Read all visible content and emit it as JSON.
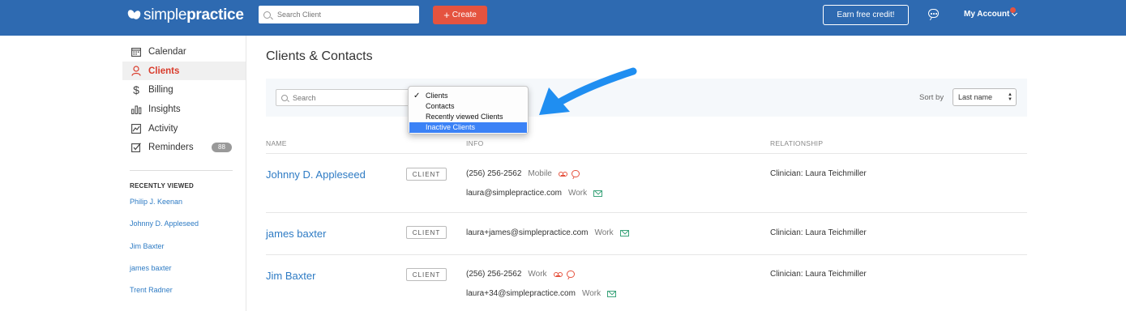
{
  "brand": {
    "name_light": "simple",
    "name_bold": "practice"
  },
  "header": {
    "search_placeholder": "Search Client",
    "create_label": "Create",
    "earn_label": "Earn free credit!",
    "account_label": "My Account"
  },
  "sidebar": {
    "items": [
      {
        "label": "Calendar",
        "icon": "calendar-icon"
      },
      {
        "label": "Clients",
        "icon": "person-icon",
        "active": true
      },
      {
        "label": "Billing",
        "icon": "dollar-icon"
      },
      {
        "label": "Insights",
        "icon": "bar-chart-icon"
      },
      {
        "label": "Activity",
        "icon": "line-chart-icon"
      },
      {
        "label": "Reminders",
        "icon": "checkbox-icon",
        "badge": "88"
      }
    ],
    "recently_viewed_title": "RECENTLY VIEWED",
    "recently_viewed": [
      "Philip J. Keenan",
      "Johnny D. Appleseed",
      "Jim Baxter",
      "james baxter",
      "Trent Radner"
    ]
  },
  "main": {
    "title": "Clients & Contacts",
    "filter_search_placeholder": "Search",
    "dropdown": {
      "options": [
        "Clients",
        "Contacts",
        "Recently viewed Clients",
        "Inactive Clients"
      ],
      "checked": "Clients",
      "highlighted": "Inactive Clients"
    },
    "sort_label": "Sort by",
    "sort_value": "Last name",
    "columns": {
      "name": "NAME",
      "info": "INFO",
      "relationship": "RELATIONSHIP"
    },
    "rows": [
      {
        "name": "Johnny D. Appleseed",
        "badge": "CLIENT",
        "phone": "(256) 256-2562",
        "phone_type": "Mobile",
        "email": "laura@simplepractice.com",
        "email_type": "Work",
        "relationship": "Clinician: Laura Teichmiller"
      },
      {
        "name": "james baxter",
        "badge": "CLIENT",
        "email": "laura+james@simplepractice.com",
        "email_type": "Work",
        "relationship": "Clinician: Laura Teichmiller"
      },
      {
        "name": "Jim Baxter",
        "badge": "CLIENT",
        "phone": "(256) 256-2562",
        "phone_type": "Work",
        "email": "laura+34@simplepractice.com",
        "email_type": "Work",
        "relationship": "Clinician: Laura Teichmiller"
      }
    ]
  },
  "colors": {
    "header_bg": "#2e6ab1",
    "accent_red": "#e5533f",
    "link_blue": "#2e7bc4",
    "arrow_blue": "#1f8ef1"
  }
}
